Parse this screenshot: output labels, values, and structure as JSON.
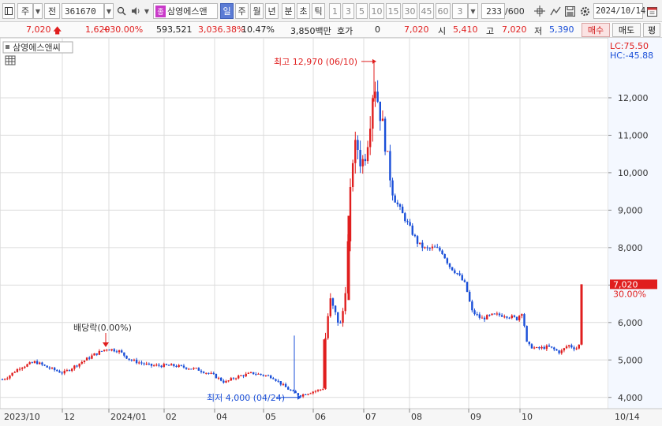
{
  "toolbar": {
    "market_label": "주",
    "all_label": "전",
    "code": "361670",
    "stock_badge": "종",
    "stock_name": "삼영에스앤",
    "periods": [
      "일",
      "주",
      "월",
      "년",
      "분",
      "초",
      "틱"
    ],
    "active_period": "일",
    "intervals": [
      "1",
      "3",
      "5",
      "10",
      "15",
      "30",
      "45",
      "60"
    ],
    "interval_value": "3",
    "count": "233",
    "count_max": "/600",
    "date": "2024/10/14"
  },
  "quote": {
    "price": "7,020",
    "change": "1,620",
    "change_pct": "+30.00%",
    "volume": "593,521",
    "volume_ratio": "3,036.38%",
    "turnover": "10.47%",
    "amount": "3,850백만",
    "hoga_label": "호가",
    "hoga_value": "0",
    "ask": "7,020",
    "open_label": "시",
    "open": "5,410",
    "high_label": "고",
    "high": "7,020",
    "low_label": "저",
    "low": "5,390",
    "buy_label": "매수",
    "sell_label": "매도",
    "eval_label": "평"
  },
  "chart": {
    "legend_name": "삼영에스앤씨",
    "lc_label": "LC:75.50",
    "hc_label": "HC:-45.88",
    "current_price_label": "7,020",
    "current_pct_label": "30.00%",
    "max_annotation": "최고 12,970 (06/10)",
    "min_annotation": "최저 4,000 (04/24)",
    "dividend_annotation": "배당락(0.00%)",
    "colors": {
      "up": "#e01e1e",
      "down": "#1a4fd8",
      "grid": "#dcdcdc"
    }
  },
  "chart_data": {
    "type": "candlestick",
    "title": "삼영에스앤씨",
    "ylim": [
      3700,
      13600
    ],
    "y_ticks": [
      4000,
      5000,
      6000,
      7000,
      8000,
      9000,
      10000,
      11000,
      12000
    ],
    "y_tick_labels": [
      "4,000",
      "5,000",
      "6,000",
      "7,000",
      "8,000",
      "9,000",
      "10,000",
      "11,000",
      "12,000"
    ],
    "x_labels": [
      "2023/10",
      "12",
      "2024/01",
      "02",
      "04",
      "05",
      "06",
      "07",
      "08",
      "09",
      "10",
      "10/14"
    ],
    "price_path": [
      [
        0,
        4450
      ],
      [
        10,
        4550
      ],
      [
        25,
        4800
      ],
      [
        45,
        4950
      ],
      [
        60,
        4800
      ],
      [
        80,
        4650
      ],
      [
        100,
        4900
      ],
      [
        120,
        5150
      ],
      [
        135,
        5300
      ],
      [
        150,
        5250
      ],
      [
        165,
        5000
      ],
      [
        190,
        4850
      ],
      [
        220,
        4850
      ],
      [
        250,
        4750
      ],
      [
        270,
        4600
      ],
      [
        285,
        4400
      ],
      [
        300,
        4550
      ],
      [
        320,
        4650
      ],
      [
        345,
        4550
      ],
      [
        360,
        4300
      ],
      [
        370,
        4150
      ],
      [
        380,
        4050
      ],
      [
        395,
        4150
      ],
      [
        405,
        4200
      ],
      [
        410,
        4250
      ],
      [
        412,
        5500
      ],
      [
        418,
        6600
      ],
      [
        425,
        6200
      ],
      [
        432,
        5900
      ],
      [
        437,
        6700
      ],
      [
        442,
        8500
      ],
      [
        446,
        10300
      ],
      [
        452,
        10800
      ],
      [
        458,
        10200
      ],
      [
        464,
        10600
      ],
      [
        468,
        11200
      ],
      [
        474,
        12500
      ],
      [
        480,
        11800
      ],
      [
        487,
        11000
      ],
      [
        492,
        10200
      ],
      [
        500,
        9300
      ],
      [
        510,
        8900
      ],
      [
        520,
        8500
      ],
      [
        530,
        8100
      ],
      [
        540,
        7950
      ],
      [
        550,
        8000
      ],
      [
        560,
        7900
      ],
      [
        570,
        7500
      ],
      [
        580,
        7300
      ],
      [
        590,
        7000
      ],
      [
        598,
        6300
      ],
      [
        610,
        6100
      ],
      [
        625,
        6200
      ],
      [
        640,
        6200
      ],
      [
        655,
        6100
      ],
      [
        662,
        6300
      ],
      [
        668,
        5400
      ],
      [
        680,
        5300
      ],
      [
        695,
        5350
      ],
      [
        710,
        5200
      ],
      [
        720,
        5400
      ],
      [
        730,
        5300
      ],
      [
        734,
        5400
      ],
      [
        737,
        7020
      ]
    ],
    "max": {
      "value": 12970,
      "date": "06/10"
    },
    "min": {
      "value": 4000,
      "date": "04/24"
    },
    "last": {
      "value": 7020,
      "change_pct": 30.0
    }
  }
}
